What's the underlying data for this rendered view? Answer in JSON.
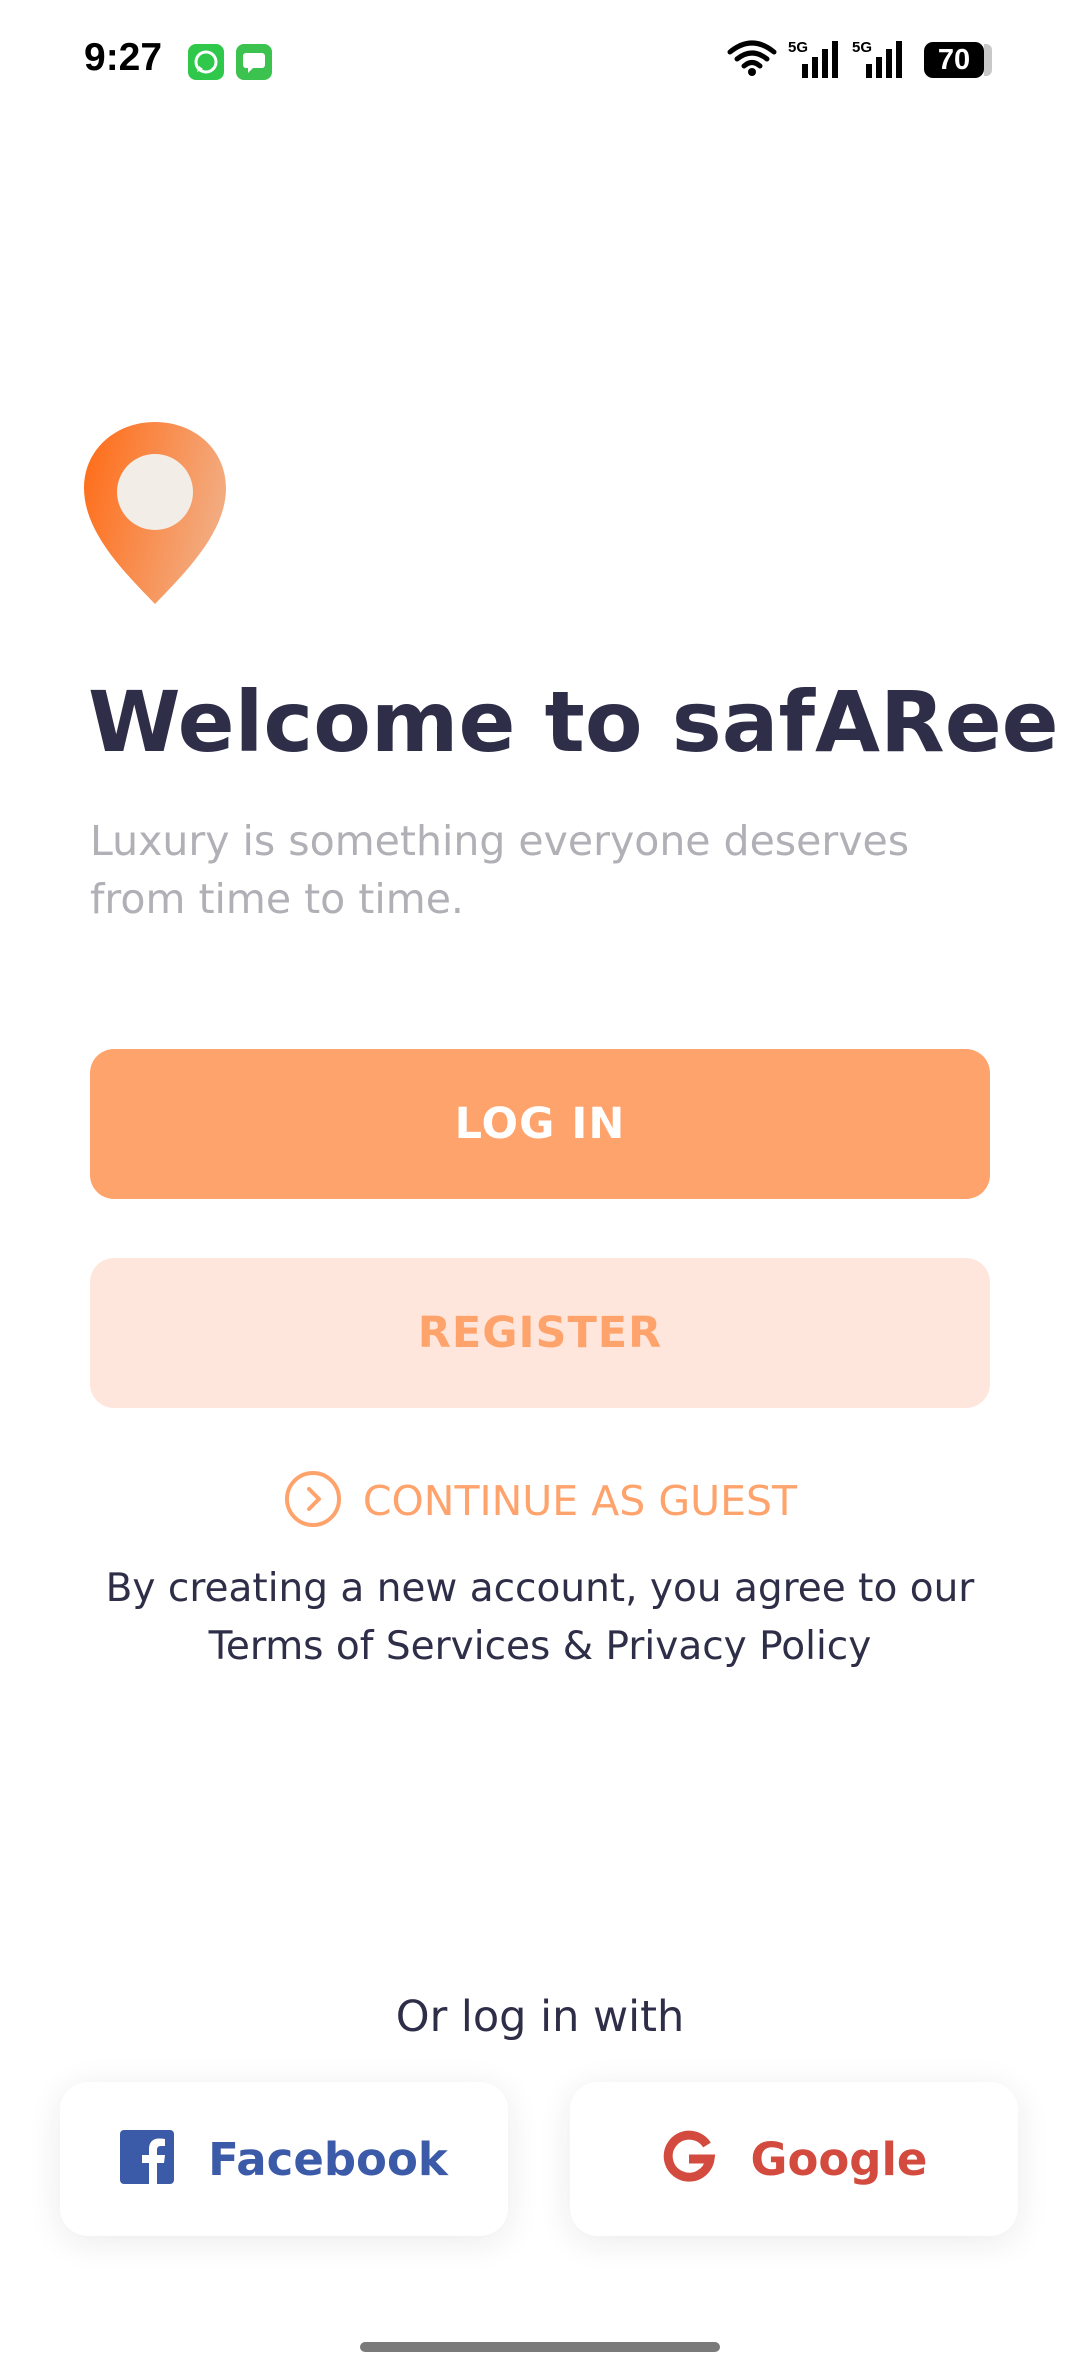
{
  "status_bar": {
    "time": "9:27",
    "battery_level": "70",
    "network_label": "5G",
    "notification_icons": [
      "whatsapp-icon",
      "messages-icon"
    ]
  },
  "welcome": {
    "title": "Welcome to safARee",
    "subtitle": "Luxury is something everyone deserves from time to time."
  },
  "actions": {
    "login_label": "LOG IN",
    "register_label": "REGISTER",
    "guest_label": "CONTINUE AS GUEST",
    "terms_text": "By creating a new account, you agree to our Terms of Services & Privacy Policy"
  },
  "social": {
    "heading": "Or log in with",
    "facebook_label": "Facebook",
    "google_label": "Google"
  },
  "colors": {
    "brand_orange": "#ffa36c",
    "brand_orange_light": "#ffe6dc",
    "heading_dark": "#2f2e48",
    "muted_text": "#b0b0b6",
    "facebook_blue": "#3b5aa8",
    "google_red": "#d34b3e"
  }
}
